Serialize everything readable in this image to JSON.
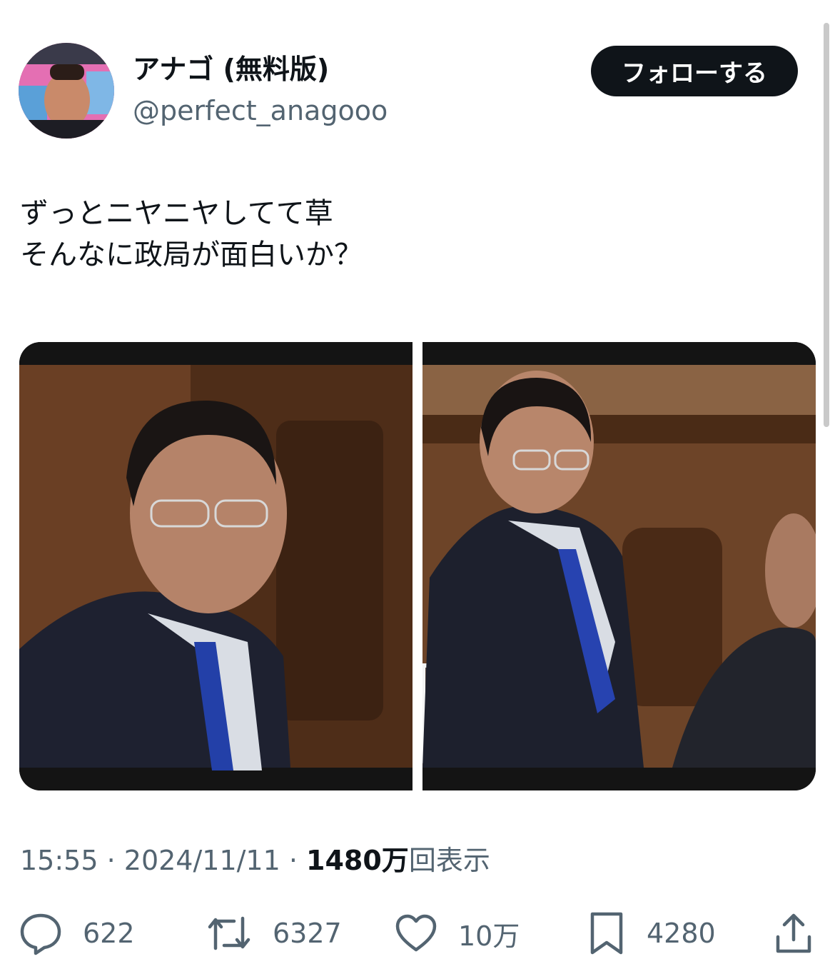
{
  "user": {
    "display_name": "アナゴ (無料版)",
    "handle": "@perfect_anagooo"
  },
  "follow_button": {
    "label": "フォローする"
  },
  "tweet": {
    "lines": [
      "ずっとニヤニヤしてて草",
      "そんなに政局が面白いか？"
    ]
  },
  "meta": {
    "time": "15:55",
    "separator": " · ",
    "date": "2024/11/11",
    "views_count": "1480万",
    "views_label": "回表示"
  },
  "actions": {
    "replies": "622",
    "retweets": "6327",
    "likes": "10万",
    "bookmarks": "4280"
  },
  "icons": [
    "reply-icon",
    "retweet-icon",
    "like-icon",
    "bookmark-icon",
    "share-icon"
  ],
  "colors": {
    "text": "#0f1419",
    "secondary": "#536471",
    "button": "#0f1419"
  }
}
